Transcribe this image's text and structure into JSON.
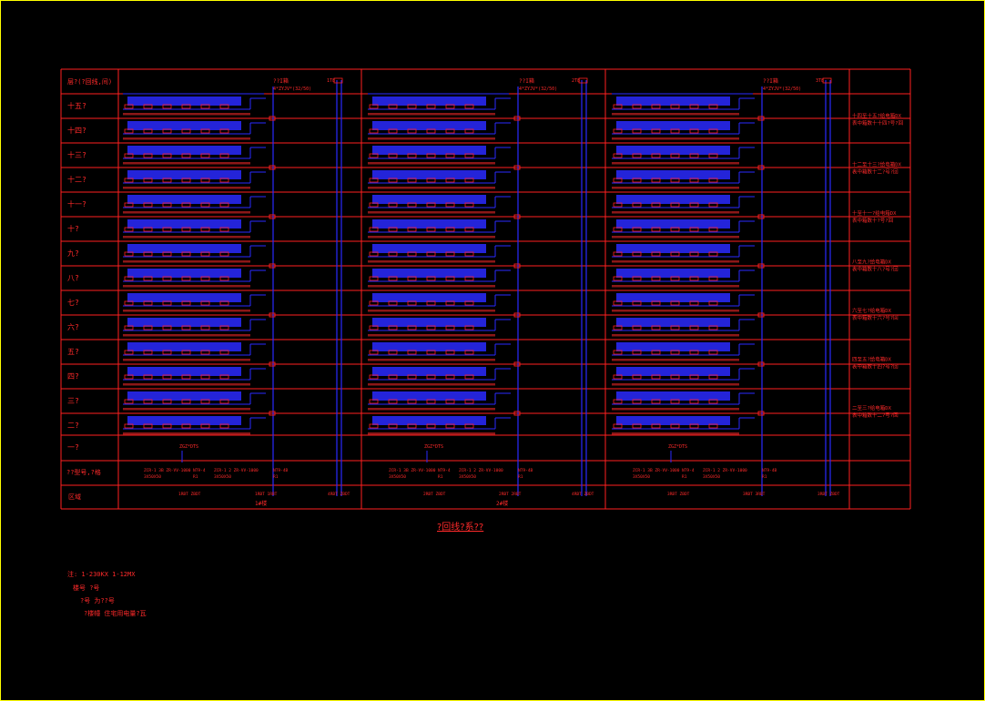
{
  "table": {
    "header": "层?(?回线,间)",
    "floors": [
      "十五?",
      "十四?",
      "十三?",
      "十二?",
      "十一?",
      "十?",
      "九?",
      "八?",
      "七?",
      "六?",
      "五?",
      "四?",
      "三?",
      "二?",
      "一?"
    ],
    "row_cable": "??型号,?格",
    "row_zone": "区域"
  },
  "buildings": [
    {
      "top_label": "??I箱",
      "top_sub": "4*ZYJV*(32/50)",
      "riser_label": "1T8",
      "first_floor_box": "ZGZ*DTS",
      "cable_notes": [
        "ZCR-1 3B ZR-VV-1000",
        "3X50X50",
        "NT9-4",
        "R1",
        "ZCR-1 2 ZR-VV-1000",
        "3X50X50",
        "NT9-4B",
        "R1"
      ],
      "zone_notes": [
        "1RBT ZBDT",
        "1RBT 1RBT",
        "4RBT ZBDT"
      ],
      "building_name": "1#楼"
    },
    {
      "top_label": "??I箱",
      "top_sub": "4*ZYJV*(32/50)",
      "riser_label": "2T8",
      "first_floor_box": "ZGZ*DTS",
      "cable_notes": [
        "ZCR-1 3B ZR-VV-1000",
        "3X50X50",
        "NT9-4",
        "R1",
        "ZCR-1 2 ZR-VV-1000",
        "3X50X50",
        "NT9-4B",
        "R1"
      ],
      "zone_notes": [
        "2RBT ZBDT",
        "2RBT 2RBT",
        "4RBT ZBDT"
      ],
      "building_name": "2#楼"
    },
    {
      "top_label": "??I箱",
      "top_sub": "4*ZYJV*(32/50)",
      "riser_label": "3T8",
      "first_floor_box": "ZGZ*DTS",
      "cable_notes": [
        "ZCR-1 3B ZR-VV-1000",
        "3X50X50",
        "NT9-4",
        "R1",
        "ZCR-1 2 ZR-VV-1000",
        "3X50X50",
        "NT9-4B",
        "R1"
      ],
      "zone_notes": [
        "3RBT ZBDT",
        "3RBT 3RBT",
        "3RBT ZBDT"
      ],
      "building_name": ""
    }
  ],
  "right_notes": [
    {
      "line1": "十四至十五?给电箱DX",
      "line2": "表中箱数十十四?号?回"
    },
    {
      "line1": "十二至十三?给电箱DX",
      "line2": "表中箱数十二?号?回"
    },
    {
      "line1": "十至十一?给电箱DX",
      "line2": "表中箱数十?号?回"
    },
    {
      "line1": "八至九?给电箱DX",
      "line2": "表中箱数十八?号?回"
    },
    {
      "line1": "六至七?给电箱DX",
      "line2": "表中箱数十六?号?回"
    },
    {
      "line1": "四至五?给电箱DX",
      "line2": "表中箱数十四?号?回"
    },
    {
      "line1": "二至三?给电箱DX",
      "line2": "表中箱数十二?号?回"
    }
  ],
  "title": "?回线?系??",
  "legend": {
    "line1": "注: 1-230KX    1-12MX",
    "line2": "楼号        ?号",
    "line3": "?号       为??号",
    "line4": "?楼幢     住宅用电量?瓦"
  },
  "colors": {
    "grid": "#ff2020",
    "wire": "#2a2aff",
    "text": "#ff2a2a",
    "border": "#ffff00"
  }
}
